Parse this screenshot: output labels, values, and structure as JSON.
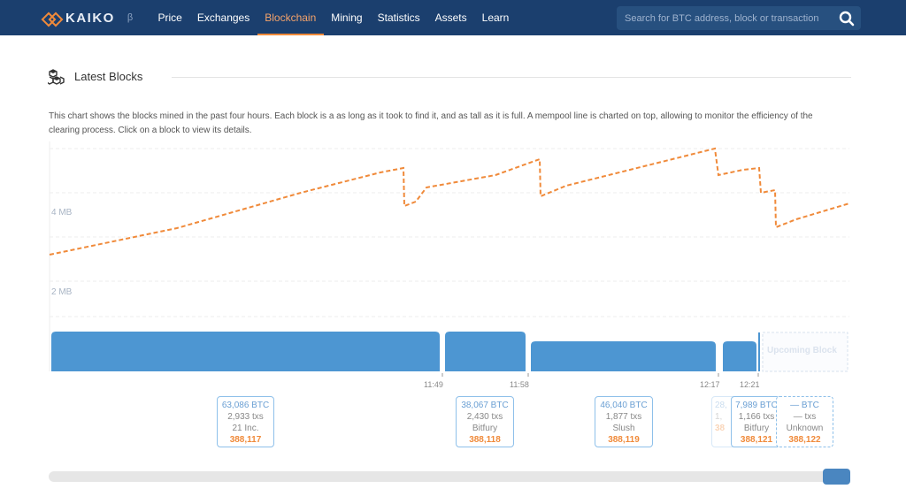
{
  "brand": {
    "name": "KAIKO",
    "beta": "β"
  },
  "nav": [
    {
      "label": "Price",
      "active": false
    },
    {
      "label": "Exchanges",
      "active": false
    },
    {
      "label": "Blockchain",
      "active": true
    },
    {
      "label": "Mining",
      "active": false
    },
    {
      "label": "Statistics",
      "active": false
    },
    {
      "label": "Assets",
      "active": false
    },
    {
      "label": "Learn",
      "active": false
    }
  ],
  "search": {
    "placeholder": "Search for BTC address, block or transaction"
  },
  "section": {
    "title": "Latest Blocks",
    "description": "This chart shows the blocks mined in the past four hours. Each block is a as long as it took to find it, and as tall as it is full. A mempool line is charted on top, allowing to monitor the efficiency of the clearing process. Click on a block to view its details."
  },
  "colors": {
    "nav_bg": "#1b3f6e",
    "accent": "#f08a3a",
    "block": "#4d96d2",
    "mempool": "#f08a3a"
  },
  "chart": {
    "y_ticks": [
      "4 MB",
      "2 MB"
    ],
    "time_labels": [
      "11:49",
      "11:58",
      "12:17",
      "12:21"
    ],
    "upcoming_label": "Upcoming Block"
  },
  "blocks": [
    {
      "btc": "63,086 BTC",
      "txs": "2,933 txs",
      "miner": "21 Inc.",
      "height": "388,117"
    },
    {
      "btc": "38,067 BTC",
      "txs": "2,430 txs",
      "miner": "Bitfury",
      "height": "388,118"
    },
    {
      "btc": "46,040 BTC",
      "txs": "1,877 txs",
      "miner": "Slush",
      "height": "388,119"
    },
    {
      "btc": "28,",
      "txs": "1,",
      "miner": "",
      "height": "38"
    },
    {
      "btc": "7,989 BTC",
      "txs": "1,166 txs",
      "miner": "Bitfury",
      "height": "388,121"
    },
    {
      "btc": "— BTC",
      "txs": "— txs",
      "miner": "Unknown",
      "height": "388,122"
    }
  ]
}
